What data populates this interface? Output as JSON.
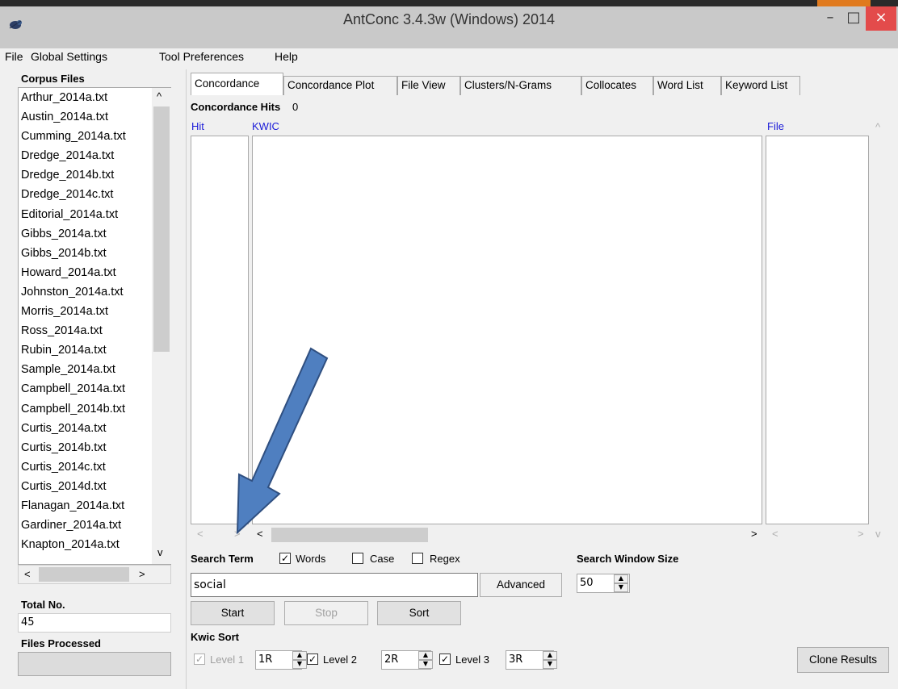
{
  "window": {
    "title": "AntConc 3.4.3w (Windows) 2014",
    "minimize": "–",
    "maximize": "□",
    "close": "×"
  },
  "menu": [
    "File",
    "Global Settings",
    "Tool Preferences",
    "Help"
  ],
  "corpus": {
    "label": "Corpus Files",
    "files": [
      "Arthur_2014a.txt",
      "Austin_2014a.txt",
      "Cumming_2014a.txt",
      "Dredge_2014a.txt",
      "Dredge_2014b.txt",
      "Dredge_2014c.txt",
      "Editorial_2014a.txt",
      "Gibbs_2014a.txt",
      "Gibbs_2014b.txt",
      "Howard_2014a.txt",
      "Johnston_2014a.txt",
      "Morris_2014a.txt",
      "Ross_2014a.txt",
      "Rubin_2014a.txt",
      "Sample_2014a.txt",
      "Campbell_2014a.txt",
      "Campbell_2014b.txt",
      "Curtis_2014a.txt",
      "Curtis_2014b.txt",
      "Curtis_2014c.txt",
      "Curtis_2014d.txt",
      "Flanagan_2014a.txt",
      "Gardiner_2014a.txt",
      "Knapton_2014a.txt"
    ],
    "total_label": "Total No.",
    "total_value": "45",
    "processed_label": "Files Processed"
  },
  "tabs": [
    "Concordance",
    "Concordance Plot",
    "File View",
    "Clusters/N-Grams",
    "Collocates",
    "Word List",
    "Keyword List"
  ],
  "concordance": {
    "hits_label": "Concordance Hits",
    "hits_value": "0",
    "col_hit": "Hit",
    "col_kwic": "KWIC",
    "col_file": "File"
  },
  "search": {
    "label": "Search Term",
    "words_label": "Words",
    "words_checked": true,
    "case_label": "Case",
    "case_checked": false,
    "regex_label": "Regex",
    "regex_checked": false,
    "value": "social",
    "advanced": "Advanced",
    "window_label": "Search Window Size",
    "window_value": "50"
  },
  "buttons": {
    "start": "Start",
    "stop": "Stop",
    "sort": "Sort",
    "clone": "Clone Results"
  },
  "kwic": {
    "label": "Kwic Sort",
    "level1_label": "Level 1",
    "level1_value": "1R",
    "level2_label": "Level 2",
    "level2_value": "2R",
    "level3_label": "Level 3",
    "level3_value": "3R"
  },
  "colors": {
    "annotation_arrow": "#4f7fc0",
    "arrow_border": "#2f4f80",
    "header_text": "#1a1ad8",
    "close_button": "#e34b4b"
  },
  "icons": {
    "scroll_up": "^",
    "scroll_down": "v",
    "scroll_left": "<",
    "scroll_right": ">",
    "check": "✓",
    "spin_up": "▲",
    "spin_down": "▼"
  }
}
